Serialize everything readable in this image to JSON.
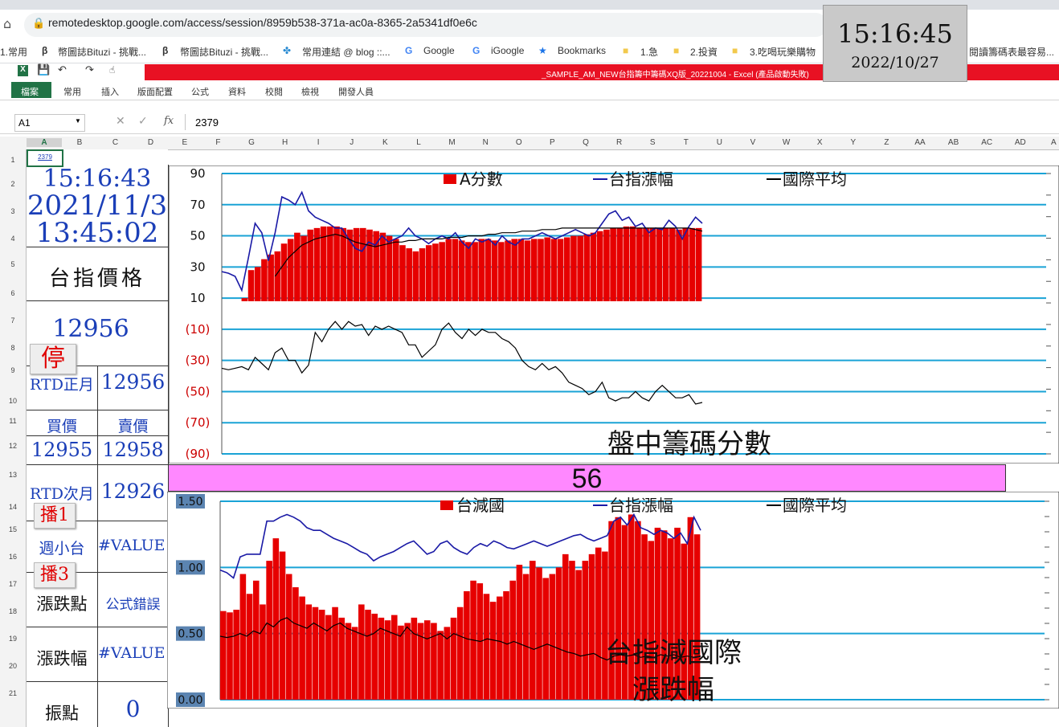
{
  "browser": {
    "url": "remotedesktop.google.com/access/session/8959b538-371a-ac0a-8365-2a5341df0e6c",
    "bookmarks": [
      "1.常用",
      "幣圖誌Bituzi - 挑戰...",
      "幣圖誌Bituzi - 挑戰...",
      "常用連結 @ blog ::...",
      "Google",
      "iGoogle",
      "Bookmarks",
      "1.急",
      "2.投資",
      "3.吃喝玩樂購物",
      "閱讀籌碼表最容易..."
    ]
  },
  "clock": {
    "time": "15:16:45",
    "date": "2022/10/27"
  },
  "excel": {
    "title": "_SAMPLE_AM_NEW台指籌中籌碼XQ版_20221004 - Excel (產品啟動失敗)",
    "ribbon_tabs": [
      "檔案",
      "常用",
      "插入",
      "版面配置",
      "公式",
      "資料",
      "校閱",
      "檢視",
      "開發人員"
    ],
    "name_box": "A1",
    "formula": "2379",
    "columns": [
      "A",
      "B",
      "C",
      "D",
      "E",
      "F",
      "G",
      "H",
      "I",
      "J",
      "K",
      "L",
      "M",
      "N",
      "O",
      "P",
      "Q",
      "R",
      "S",
      "T",
      "U",
      "V",
      "W",
      "X",
      "Y",
      "Z",
      "AA",
      "AB",
      "AC",
      "AD",
      "A"
    ],
    "rows": [
      "1",
      "2",
      "3",
      "4",
      "5",
      "6",
      "7",
      "8",
      "9",
      "10",
      "11",
      "12",
      "13",
      "14",
      "15",
      "16",
      "17",
      "18",
      "19",
      "20",
      "21"
    ]
  },
  "cells": {
    "a1": "2379",
    "time": "15:16:43",
    "date": "2021/11/3",
    "time2": "13:45:02",
    "index_label": "台指價格",
    "index_price": "12956",
    "rtd_front_label": "RTD正月",
    "rtd_front_value": "12956",
    "bid_label": "買價",
    "ask_label": "賣價",
    "bid": "12955",
    "ask": "12958",
    "rtd_next_label": "RTD次月",
    "rtd_next_value": "12926",
    "weekly_label": "週小台",
    "weekly_value": "#VALUE!",
    "change_pts_label": "漲跌點",
    "change_pts_value": "公式錯誤",
    "change_pct_label": "漲跌幅",
    "change_pct_value": "#VALUE!",
    "amplitude_label": "振點",
    "amplitude_value": "0"
  },
  "buttons": {
    "stop": "停",
    "play1": "播1",
    "play3": "播3"
  },
  "banner_value": "56",
  "colors": {
    "bar": "#e60000",
    "blue_line": "#1a1aa6",
    "black_line": "#000000",
    "grid": "#1aa3d6",
    "banner": "#ff88ff",
    "excel_title": "#e81123"
  },
  "chart_data": [
    {
      "type": "bar",
      "title": "盤中籌碼分數",
      "legend": [
        "A分數",
        "台指漲幅",
        "國際平均"
      ],
      "legend_position": "top",
      "ylim": [
        -90,
        90
      ],
      "yticks": [
        "90",
        "70",
        "50",
        "30",
        "10",
        "(10)",
        "(30)",
        "(50)",
        "(70)",
        "(90)"
      ],
      "grid": true,
      "series": [
        {
          "name": "A分數",
          "type": "bar",
          "values": [
            8,
            8,
            8,
            10,
            28,
            30,
            35,
            38,
            40,
            45,
            48,
            52,
            50,
            54,
            55,
            56,
            56,
            56,
            55,
            54,
            55,
            55,
            54,
            53,
            52,
            50,
            48,
            44,
            42,
            40,
            42,
            44,
            45,
            46,
            48,
            48,
            47,
            46,
            46,
            48,
            48,
            47,
            46,
            47,
            48,
            48,
            47,
            48,
            48,
            49,
            48,
            48,
            49,
            50,
            50,
            51,
            52,
            53,
            54,
            55,
            55,
            56,
            56,
            55,
            55,
            55,
            55,
            55,
            55,
            54,
            55,
            55,
            55
          ]
        },
        {
          "name": "台指漲幅",
          "type": "line",
          "values": [
            27,
            26,
            24,
            15,
            36,
            58,
            52,
            34,
            52,
            75,
            73,
            70,
            78,
            66,
            62,
            60,
            58,
            55,
            55,
            48,
            42,
            40,
            46,
            44,
            50,
            46,
            48,
            50,
            55,
            50,
            48,
            45,
            48,
            50,
            48,
            52,
            46,
            42,
            48,
            46,
            48,
            44,
            50,
            46,
            44,
            48,
            48,
            50,
            52,
            50,
            48,
            50,
            52,
            54,
            52,
            50,
            52,
            58,
            64,
            66,
            60,
            62,
            56,
            58,
            52,
            55,
            54,
            60,
            56,
            48,
            56,
            62,
            58
          ]
        },
        {
          "name": "國際平均",
          "type": "line",
          "values": [
            null,
            null,
            null,
            null,
            null,
            null,
            null,
            null,
            24,
            30,
            36,
            40,
            44,
            46,
            48,
            49,
            50,
            51,
            50,
            48,
            46,
            45,
            44,
            43,
            44,
            45,
            46,
            46,
            47,
            47,
            48,
            48,
            48,
            48,
            49,
            49,
            49,
            50,
            50,
            50,
            51,
            51,
            52,
            52,
            52,
            53,
            53,
            53,
            54,
            54,
            54,
            55,
            55,
            55,
            55,
            55,
            55,
            55,
            55,
            55,
            55,
            55,
            55,
            55,
            55,
            55,
            55,
            55,
            55,
            55,
            55,
            54,
            53
          ]
        },
        {
          "name": "",
          "type": "line",
          "values": [
            -35,
            -36,
            -35,
            -34,
            -36,
            -28,
            -32,
            -36,
            -25,
            -22,
            -30,
            -30,
            -38,
            -33,
            -12,
            -18,
            -10,
            -5,
            -10,
            -5,
            -8,
            -7,
            -14,
            -8,
            -10,
            -8,
            -10,
            -12,
            -20,
            -20,
            -28,
            -24,
            -20,
            -10,
            -6,
            -12,
            -16,
            -10,
            -14,
            -10,
            -12,
            -12,
            -16,
            -18,
            -22,
            -30,
            -34,
            -36,
            -32,
            -36,
            -34,
            -38,
            -44,
            -46,
            -48,
            -52,
            -50,
            -44,
            -54,
            -56,
            -54,
            -54,
            -50,
            -54,
            -56,
            -50,
            -46,
            -50,
            -54,
            -54,
            -52,
            -58,
            -57
          ]
        }
      ]
    },
    {
      "type": "bar",
      "title": "台指減國際漲跌幅",
      "legend": [
        "台減國",
        "台指漲幅",
        "國際平均"
      ],
      "legend_position": "top",
      "ylim": [
        0,
        1.5
      ],
      "yticks": [
        "1.50",
        "1.00",
        "0.50",
        "0.00"
      ],
      "grid": true,
      "series": [
        {
          "name": "台減國",
          "type": "bar",
          "values": [
            0.67,
            0.66,
            0.68,
            0.95,
            0.8,
            0.9,
            0.72,
            1.05,
            1.22,
            1.12,
            0.95,
            0.85,
            0.78,
            0.72,
            0.7,
            0.68,
            0.64,
            0.7,
            0.62,
            0.58,
            0.55,
            0.72,
            0.68,
            0.65,
            0.62,
            0.6,
            0.64,
            0.56,
            0.58,
            0.62,
            0.58,
            0.6,
            0.58,
            0.52,
            0.55,
            0.62,
            0.7,
            0.82,
            0.9,
            0.88,
            0.8,
            0.74,
            0.78,
            0.82,
            0.9,
            1.02,
            0.95,
            1.05,
            1.0,
            0.92,
            0.95,
            1.0,
            1.1,
            1.05,
            0.98,
            1.05,
            1.1,
            1.15,
            1.12,
            1.35,
            1.38,
            1.32,
            1.4,
            1.35,
            1.25,
            1.2,
            1.3,
            1.28,
            1.22,
            1.3,
            1.18,
            1.38,
            1.25
          ]
        },
        {
          "name": "台指漲幅",
          "type": "line",
          "values": [
            0.98,
            0.96,
            0.92,
            1.08,
            1.1,
            1.1,
            1.1,
            1.35,
            1.35,
            1.38,
            1.4,
            1.38,
            1.35,
            1.3,
            1.28,
            1.28,
            1.25,
            1.22,
            1.2,
            1.18,
            1.15,
            1.12,
            1.1,
            1.05,
            1.08,
            1.1,
            1.12,
            1.15,
            1.18,
            1.2,
            1.15,
            1.1,
            1.12,
            1.18,
            1.2,
            1.15,
            1.12,
            1.1,
            1.15,
            1.18,
            1.16,
            1.2,
            1.18,
            1.15,
            1.14,
            1.16,
            1.18,
            1.2,
            1.18,
            1.16,
            1.18,
            1.2,
            1.22,
            1.24,
            1.25,
            1.22,
            1.2,
            1.22,
            1.24,
            1.35,
            1.38,
            1.32,
            1.4,
            1.3,
            1.28,
            1.25,
            1.28,
            1.26,
            1.22,
            1.26,
            1.18,
            1.38,
            1.28
          ]
        },
        {
          "name": "國際平均",
          "type": "line",
          "values": [
            0.48,
            0.47,
            0.48,
            0.5,
            0.48,
            0.52,
            0.5,
            0.58,
            0.55,
            0.6,
            0.62,
            0.58,
            0.56,
            0.54,
            0.58,
            0.55,
            0.52,
            0.56,
            0.58,
            0.54,
            0.52,
            0.5,
            0.48,
            0.5,
            0.54,
            0.52,
            0.5,
            0.48,
            0.55,
            0.5,
            0.48,
            0.46,
            0.48,
            0.5,
            0.46,
            0.5,
            0.48,
            0.46,
            0.45,
            0.44,
            0.46,
            0.45,
            0.44,
            0.42,
            0.44,
            0.42,
            0.4,
            0.38,
            0.4,
            0.42,
            0.4,
            0.38,
            0.36,
            0.35,
            0.33,
            0.34,
            0.35,
            0.32,
            0.3,
            0.33,
            0.34,
            0.33,
            0.34,
            0.32,
            0.33,
            0.32,
            0.34,
            0.33,
            0.34,
            0.32,
            0.33,
            0.32,
            0.33
          ]
        }
      ]
    }
  ]
}
